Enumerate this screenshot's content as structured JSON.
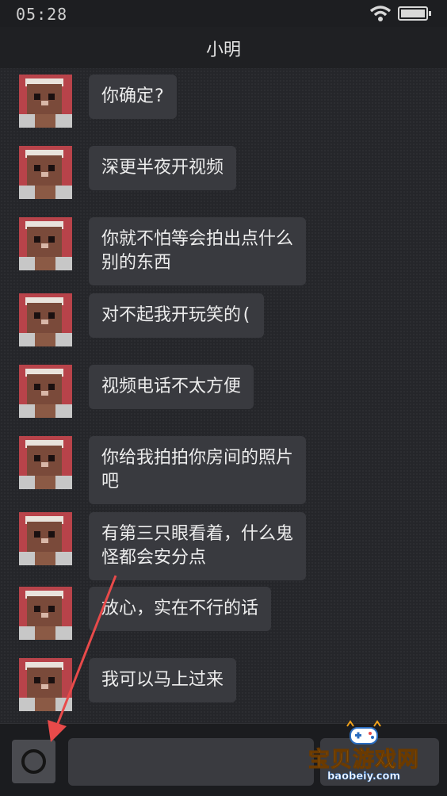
{
  "status_bar": {
    "time": "05:28",
    "wifi_icon": "wifi-icon",
    "battery_icon": "battery-icon"
  },
  "header": {
    "title": "小明"
  },
  "messages": [
    {
      "text": "你确定?"
    },
    {
      "text": "深更半夜开视频"
    },
    {
      "text": "你就不怕等会拍出点什么\n别的东西"
    },
    {
      "text": "对不起我开玩笑的("
    },
    {
      "text": "视频电话不太方便"
    },
    {
      "text": "你给我拍拍你房间的照片\n吧"
    },
    {
      "text": "有第三只眼看着，什么鬼\n怪都会安分点"
    },
    {
      "text": "放心，实在不行的话"
    },
    {
      "text": "我可以马上过来"
    }
  ],
  "input_bar": {
    "camera_icon": "camera-icon",
    "message_value": ""
  },
  "watermark": {
    "text": "宝贝游戏网",
    "url": "baobeiy.com"
  },
  "annotation": {
    "arrow_color": "#e84a4a"
  }
}
